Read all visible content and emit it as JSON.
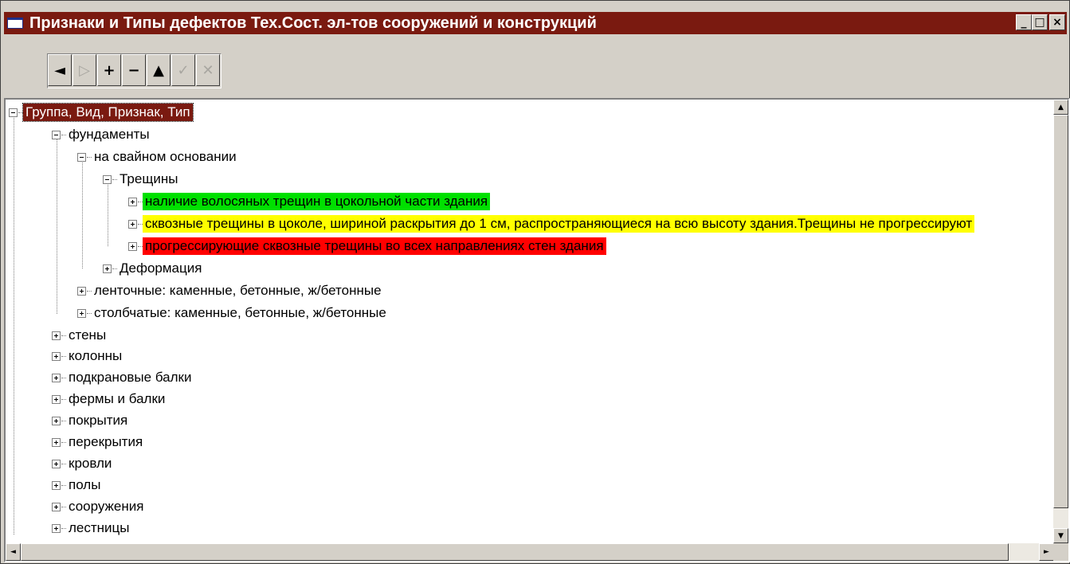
{
  "window": {
    "title": "Признаки и Типы дефектов Тех.Сост. эл-тов сооружений и конструкций",
    "buttons": {
      "minimize": "_",
      "maximize": "□",
      "close": "×"
    }
  },
  "toolbar": {
    "buttons": [
      {
        "name": "prior",
        "glyph": "◄",
        "enabled": true
      },
      {
        "name": "next",
        "glyph": "▷",
        "enabled": false
      },
      {
        "name": "insert",
        "glyph": "+",
        "enabled": true
      },
      {
        "name": "delete",
        "glyph": "−",
        "enabled": true
      },
      {
        "name": "edit",
        "glyph": "▲",
        "enabled": true
      },
      {
        "name": "post",
        "glyph": "✓",
        "enabled": false
      },
      {
        "name": "cancel",
        "glyph": "✕",
        "enabled": false
      }
    ]
  },
  "tree": {
    "root": "Группа, Вид, Признак, Тип",
    "foundations": "фундаменты",
    "pile_foundation": "на свайном основании",
    "cracks": "Трещины",
    "crack_green": "наличие волосяных трещин в цокольной части здания",
    "crack_yellow": "сквозные трещины в цоколе, шириной раскрытия до 1 см, распространяющиеся на всю высоту здания.Трещины не прогрессируют",
    "crack_red": "прогрессирующие сквозные трещины во всех направлениях стен здания",
    "deformation": "Деформация",
    "strip_foundation": "ленточные: каменные, бетонные, ж/бетонные",
    "column_foundation": "столбчатые: каменные, бетонные, ж/бетонные",
    "walls": "стены",
    "columns": "колонны",
    "crane_beams": "подкрановые балки",
    "trusses": "фермы и балки",
    "coverings": "покрытия",
    "floors_slabs": "перекрытия",
    "roofs": "кровли",
    "floors": "полы",
    "structures": "сооружения",
    "stairs": "лестницы"
  },
  "colors": {
    "title_bar": "#7a1a10",
    "green": "#00e000",
    "yellow": "#ffff00",
    "red": "#ff0000"
  }
}
